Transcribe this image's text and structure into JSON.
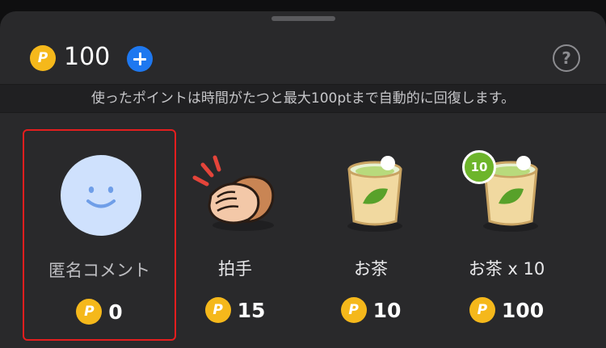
{
  "header": {
    "balance": "100",
    "coin_symbol": "P"
  },
  "notice": "使ったポイントは時間がたつと最大100ptまで自動的に回復します。",
  "items": [
    {
      "label": "匿名コメント",
      "price": "0",
      "selected": true,
      "icon": "smiley-face-icon"
    },
    {
      "label": "拍手",
      "price": "15",
      "selected": false,
      "icon": "clapping-hands-icon"
    },
    {
      "label": "お茶",
      "price": "10",
      "selected": false,
      "icon": "tea-cup-icon"
    },
    {
      "label": "お茶 x 10",
      "price": "100",
      "selected": false,
      "icon": "tea-cup-x10-icon",
      "badge": "10"
    }
  ],
  "colors": {
    "accent_blue": "#1e78f0",
    "coin_gold": "#f5b81b",
    "selection_red": "#e41e1e",
    "tea_green": "#6db52b"
  }
}
